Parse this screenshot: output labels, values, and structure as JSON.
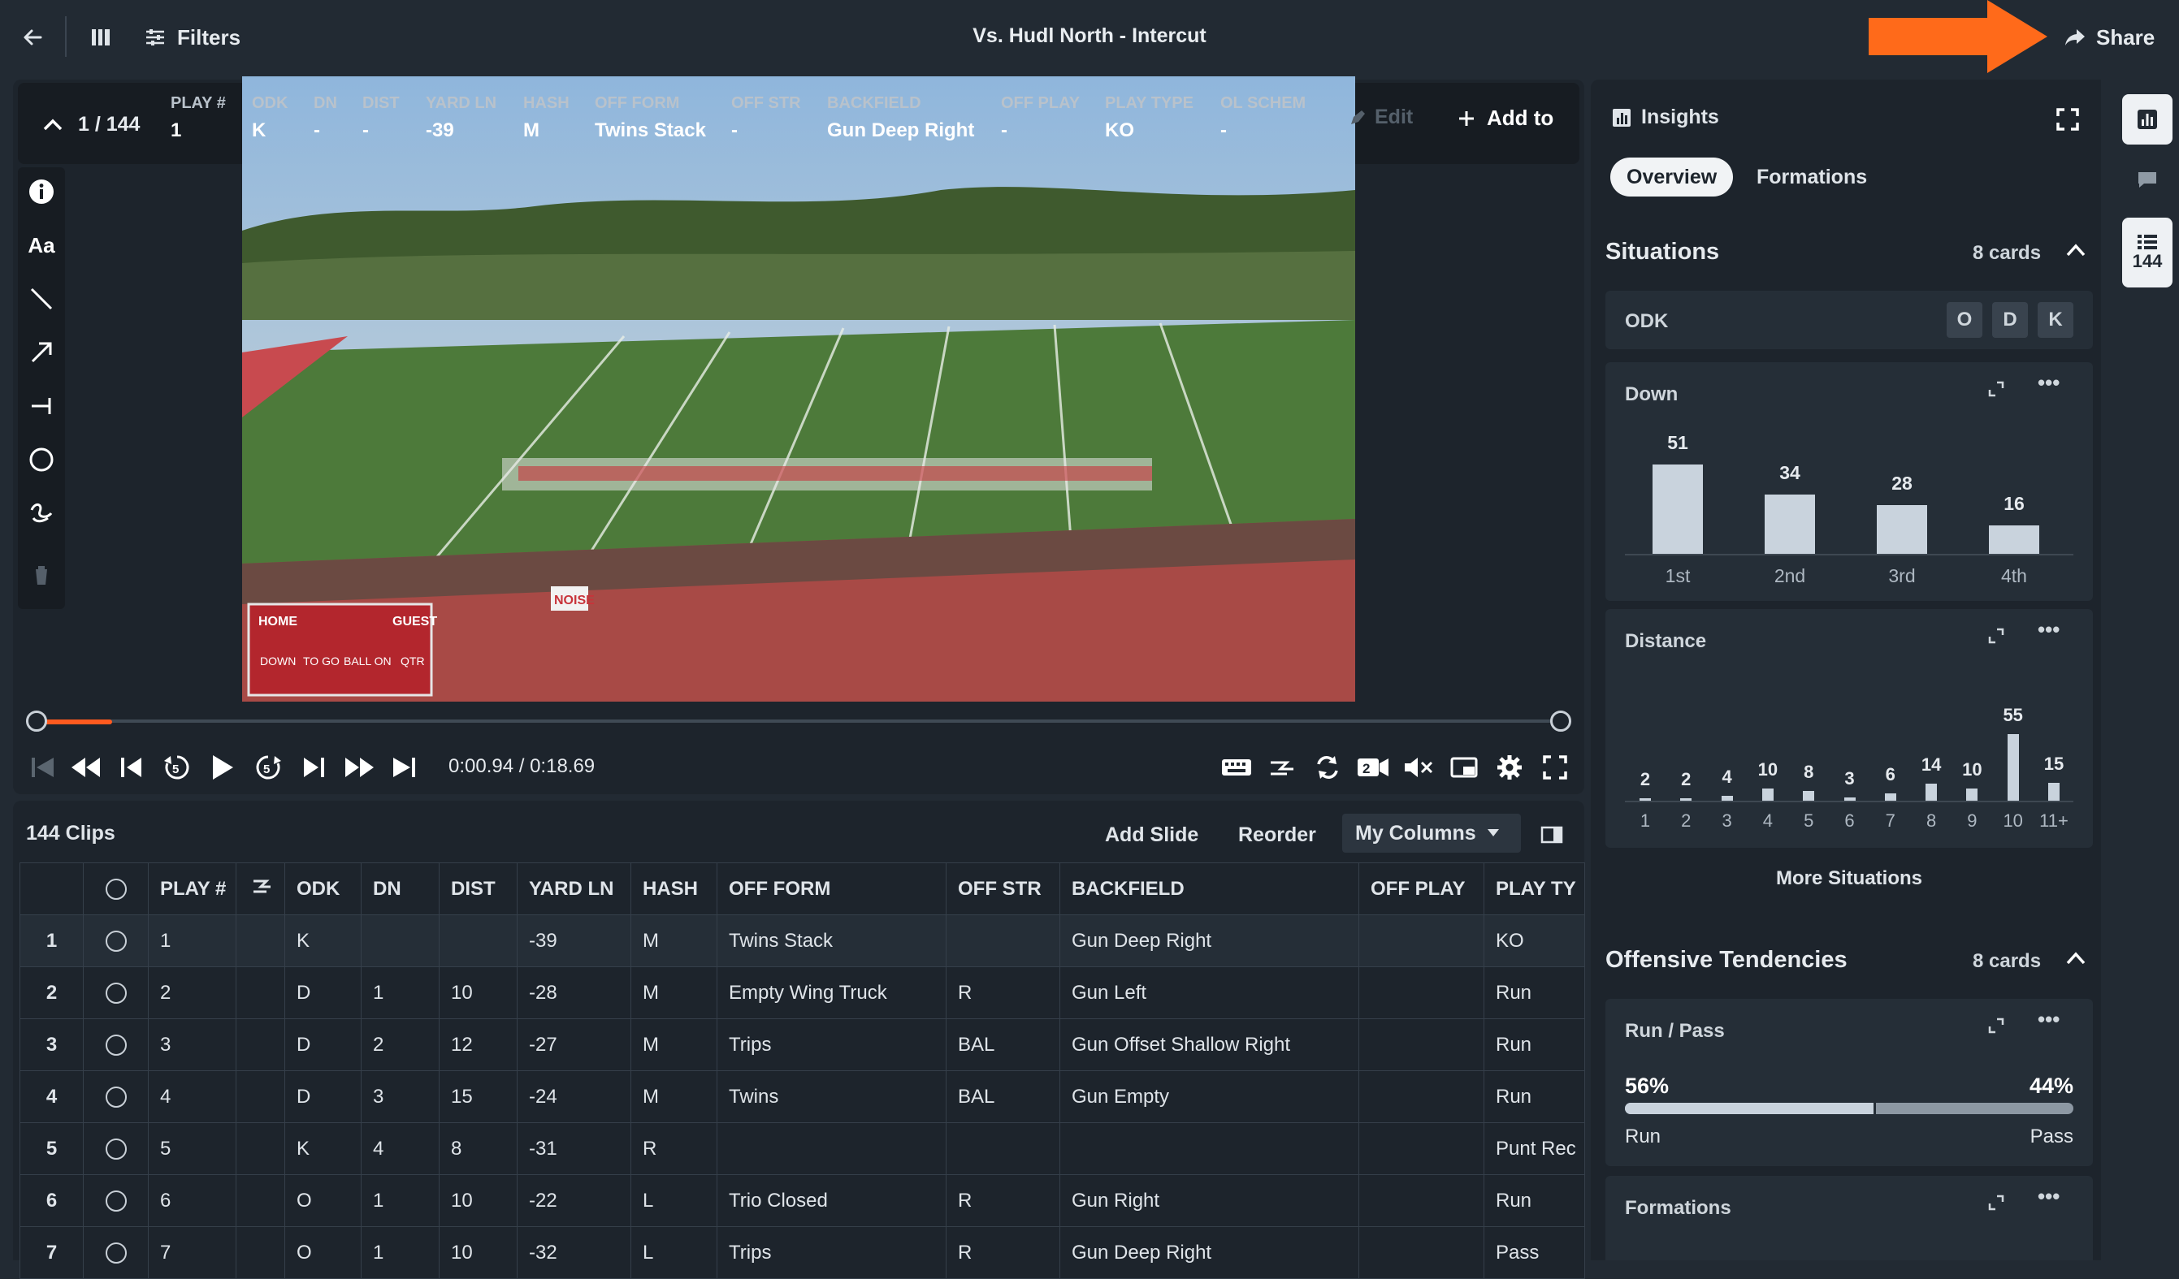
{
  "topbar": {
    "filters_label": "Filters",
    "title": "Vs. Hudl North - Intercut",
    "share_label": "Share",
    "accent": "#ff6a1a"
  },
  "video": {
    "counter": "1 / 144",
    "meta": [
      {
        "label": "PLAY #",
        "value": "1"
      },
      {
        "label": "ODK",
        "value": "K"
      },
      {
        "label": "DN",
        "value": "-"
      },
      {
        "label": "DIST",
        "value": "-"
      },
      {
        "label": "YARD LN",
        "value": "-39"
      },
      {
        "label": "HASH",
        "value": "M"
      },
      {
        "label": "OFF FORM",
        "value": "Twins Stack"
      },
      {
        "label": "OFF STR",
        "value": "-"
      },
      {
        "label": "BACKFIELD",
        "value": "Gun Deep Right"
      },
      {
        "label": "OFF PLAY",
        "value": "-"
      },
      {
        "label": "PLAY TYPE",
        "value": "KO"
      },
      {
        "label": "OL SCHEM",
        "value": "-"
      }
    ],
    "edit_label": "Edit",
    "add_to_label": "Add to",
    "scoreboard": {
      "home": "HOME",
      "guest": "GUEST",
      "down": "DOWN",
      "to_go": "TO GO",
      "ball_on": "BALL ON",
      "qtr": "QTR"
    },
    "noise_sign": "NOISE",
    "time": "0:00.94 / 0:18.69",
    "progress": 0.05
  },
  "clips": {
    "count_label": "144 Clips",
    "add_slide": "Add Slide",
    "reorder": "Reorder",
    "my_columns": "My Columns",
    "columns": [
      "",
      "",
      "PLAY #",
      "",
      "ODK",
      "DN",
      "DIST",
      "YARD LN",
      "HASH",
      "OFF FORM",
      "OFF STR",
      "BACKFIELD",
      "OFF PLAY",
      "PLAY TY"
    ],
    "rows": [
      {
        "n": "1",
        "play": "1",
        "odk": "K",
        "dn": "",
        "dist": "",
        "yard": "-39",
        "hash": "M",
        "form": "Twins Stack",
        "str": "",
        "back": "Gun Deep Right",
        "offplay": "",
        "type": "KO"
      },
      {
        "n": "2",
        "play": "2",
        "odk": "D",
        "dn": "1",
        "dist": "10",
        "yard": "-28",
        "hash": "M",
        "form": "Empty Wing Truck",
        "str": "R",
        "back": "Gun Left",
        "offplay": "",
        "type": "Run"
      },
      {
        "n": "3",
        "play": "3",
        "odk": "D",
        "dn": "2",
        "dist": "12",
        "yard": "-27",
        "hash": "M",
        "form": "Trips",
        "str": "BAL",
        "back": "Gun Offset Shallow Right",
        "offplay": "",
        "type": "Run"
      },
      {
        "n": "4",
        "play": "4",
        "odk": "D",
        "dn": "3",
        "dist": "15",
        "yard": "-24",
        "hash": "M",
        "form": "Twins",
        "str": "BAL",
        "back": "Gun Empty",
        "offplay": "",
        "type": "Run"
      },
      {
        "n": "5",
        "play": "5",
        "odk": "K",
        "dn": "4",
        "dist": "8",
        "yard": "-31",
        "hash": "R",
        "form": "",
        "str": "",
        "back": "",
        "offplay": "",
        "type": "Punt Rec"
      },
      {
        "n": "6",
        "play": "6",
        "odk": "O",
        "dn": "1",
        "dist": "10",
        "yard": "-22",
        "hash": "L",
        "form": "Trio Closed",
        "str": "R",
        "back": "Gun Right",
        "offplay": "",
        "type": "Run"
      },
      {
        "n": "7",
        "play": "7",
        "odk": "O",
        "dn": "1",
        "dist": "10",
        "yard": "-32",
        "hash": "L",
        "form": "Trips",
        "str": "R",
        "back": "Gun Deep Right",
        "offplay": "",
        "type": "Pass"
      }
    ]
  },
  "insights": {
    "title": "Insights",
    "tabs": [
      "Overview",
      "Formations"
    ],
    "situations": {
      "title": "Situations",
      "count": "8 cards"
    },
    "odk": {
      "title": "ODK",
      "chips": [
        "O",
        "D",
        "K"
      ]
    },
    "down": {
      "title": "Down"
    },
    "distance": {
      "title": "Distance"
    },
    "more_situations": "More Situations",
    "offensive": {
      "title": "Offensive Tendencies",
      "count": "8 cards"
    },
    "run_pass": {
      "title": "Run / Pass",
      "run_pct": "56%",
      "pass_pct": "44%",
      "run_label": "Run",
      "pass_label": "Pass",
      "run_fraction": 0.56
    },
    "formations_card": {
      "title": "Formations"
    },
    "rail_count": "144"
  },
  "chart_data": [
    {
      "type": "bar",
      "title": "Down",
      "categories": [
        "1st",
        "2nd",
        "3rd",
        "4th"
      ],
      "values": [
        51,
        34,
        28,
        16
      ]
    },
    {
      "type": "bar",
      "title": "Distance",
      "categories": [
        "1",
        "2",
        "3",
        "4",
        "5",
        "6",
        "7",
        "8",
        "9",
        "10",
        "11+"
      ],
      "values": [
        2,
        2,
        4,
        10,
        8,
        3,
        6,
        14,
        10,
        55,
        15
      ]
    }
  ]
}
